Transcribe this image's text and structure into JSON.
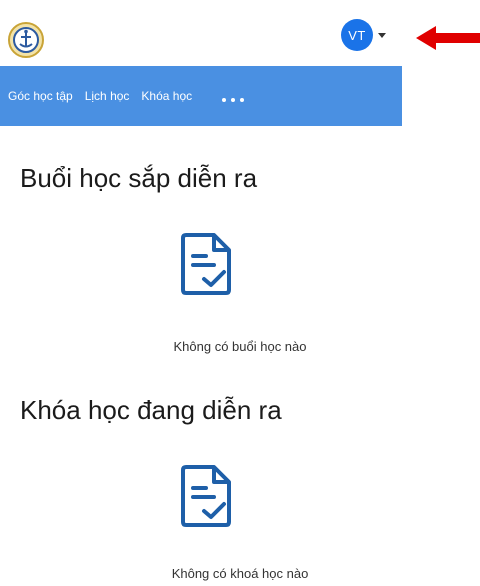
{
  "header": {
    "avatar_initials": "VT",
    "icons": {
      "logo": "maritime-school-logo",
      "caret": "caret-down-icon",
      "annotation": "red-arrow-left"
    }
  },
  "nav": {
    "items": [
      {
        "label": "Góc học tập"
      },
      {
        "label": "Lịch học"
      },
      {
        "label": "Khóa học"
      }
    ],
    "more_icon": "more-dots-icon",
    "background": "#4a90e2"
  },
  "sections": [
    {
      "title": "Buổi học sắp diễn ra",
      "empty_text": "Không có buổi học nào",
      "icon": "document-check-icon"
    },
    {
      "title": "Khóa học đang diễn ra",
      "empty_text": "Không có khoá học nào",
      "icon": "document-check-icon"
    }
  ],
  "colors": {
    "accent": "#1a73e8",
    "icon_stroke": "#1e5fa8",
    "annotation_red": "#e00000"
  }
}
